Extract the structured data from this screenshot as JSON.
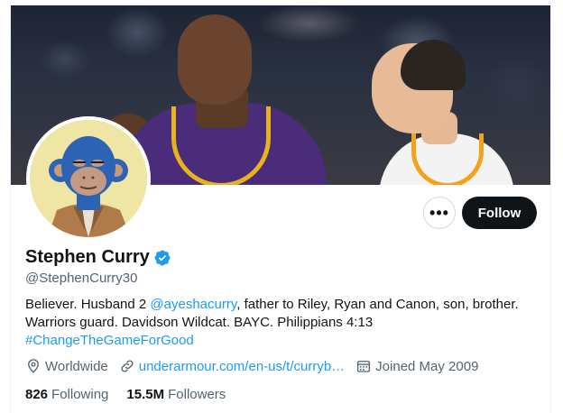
{
  "profile": {
    "name": "Stephen Curry",
    "handle": "@StephenCurry30",
    "bio": {
      "line1_pre": "Believer. Husband 2 ",
      "line1_mention": "@ayeshacurry",
      "line1_post": ", father to Riley, Ryan and Canon, son, brother.",
      "line2": "Warriors guard. Davidson Wildcat. BAYC. Philippians 4:13",
      "line3_hashtag": "#ChangeTheGameForGood"
    },
    "location": "Worldwide",
    "website": "underarmour.com/en-us/t/curryb…",
    "joined": "Joined May 2009",
    "following_count": "826",
    "following_label": "Following",
    "followers_count": "15.5M",
    "followers_label": "Followers"
  },
  "actions": {
    "more_label": "•••",
    "follow_label": "Follow"
  },
  "icons": {
    "verified": "verified-badge-icon",
    "location": "location-pin-icon",
    "link": "link-icon",
    "calendar": "calendar-icon",
    "more": "more-options-icon"
  },
  "colors": {
    "accent": "#1d9bf0",
    "text_primary": "#0f1419",
    "text_secondary": "#536471",
    "button_dark": "#0f1419"
  }
}
